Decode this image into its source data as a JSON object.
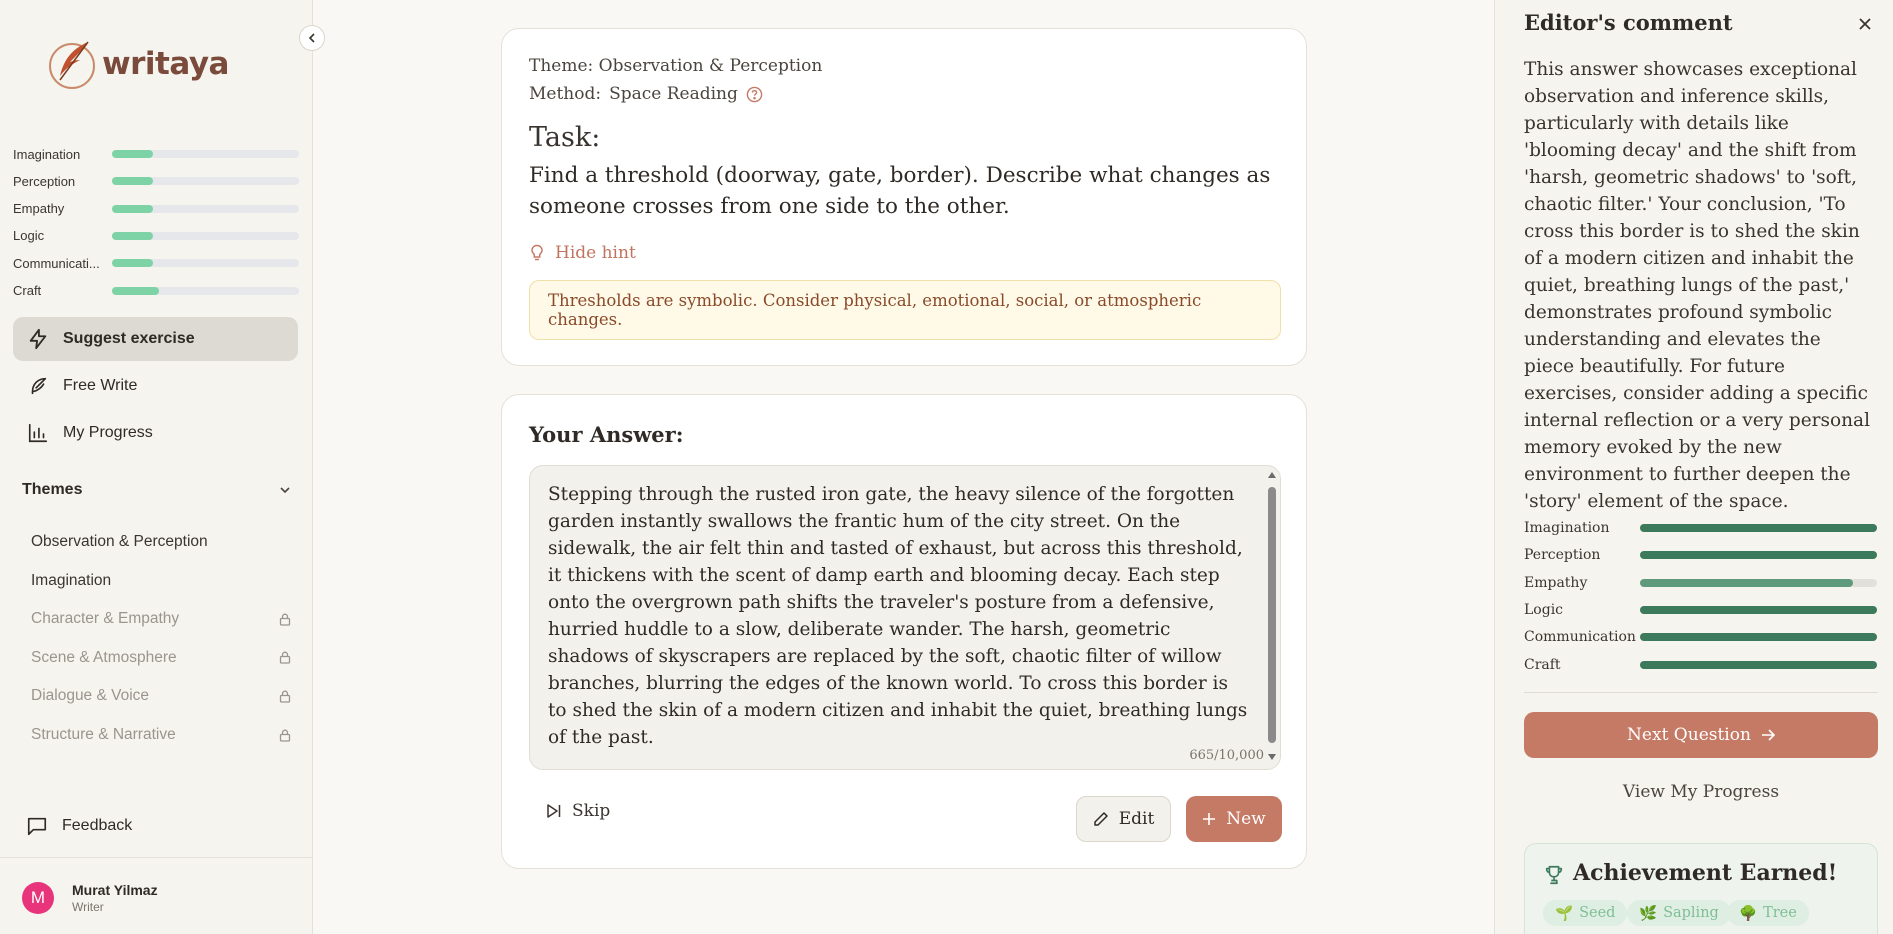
{
  "app": {
    "logo_text": "writaya"
  },
  "sidebar": {
    "skills": [
      {
        "name": "Imagination",
        "level": 0.22
      },
      {
        "name": "Perception",
        "level": 0.22
      },
      {
        "name": "Empathy",
        "level": 0.22
      },
      {
        "name": "Logic",
        "level": 0.22
      },
      {
        "name": "Communicati...",
        "level": 0.22
      },
      {
        "name": "Craft",
        "level": 0.25
      }
    ],
    "nav": [
      {
        "label": "Suggest exercise",
        "icon": "lightning-icon",
        "active": true
      },
      {
        "label": "Free Write",
        "icon": "feather-icon",
        "active": false
      },
      {
        "label": "My Progress",
        "icon": "bar-chart-icon",
        "active": false
      }
    ],
    "themes_label": "Themes",
    "themes": [
      {
        "label": "Observation & Perception",
        "locked": false
      },
      {
        "label": "Imagination",
        "locked": false
      },
      {
        "label": "Character & Empathy",
        "locked": true
      },
      {
        "label": "Scene & Atmosphere",
        "locked": true
      },
      {
        "label": "Dialogue & Voice",
        "locked": true
      },
      {
        "label": "Structure & Narrative",
        "locked": true
      }
    ],
    "feedback_label": "Feedback",
    "user": {
      "initial": "M",
      "name": "Murat Yilmaz",
      "role": "Writer",
      "avatar_color": "#e8347a"
    }
  },
  "task": {
    "theme_line": "Theme: Observation & Perception",
    "method_label": "Method:",
    "method_value": "Space Reading",
    "title": "Task:",
    "text": "Find a threshold (doorway, gate, border). Describe what changes as someone crosses from one side to the other.",
    "hint_toggle": "Hide hint",
    "hint": "Thresholds are symbolic. Consider physical, emotional, social, or atmospheric changes."
  },
  "answer": {
    "title": "Your Answer:",
    "text": "Stepping through the rusted iron gate, the heavy silence of the forgotten garden instantly swallows the frantic hum of the city street. On the sidewalk, the air felt thin and tasted of exhaust, but across this threshold, it thickens with the scent of damp earth and blooming decay. Each step onto the overgrown path shifts the traveler's posture from a defensive, hurried huddle to a slow, deliberate wander. The harsh, geometric shadows of skyscrapers are replaced by the soft, chaotic filter of willow branches, blurring the edges of the known world. To cross this border is to shed the skin of a modern citizen and inhabit the quiet, breathing lungs of the past.",
    "char_count": "665/10,000",
    "skip_label": "Skip",
    "edit_label": "Edit",
    "new_label": "New"
  },
  "editor": {
    "title": "Editor's comment",
    "comment": "This answer showcases exceptional observation and inference skills, particularly with details like 'blooming decay' and the shift from 'harsh, geometric shadows' to 'soft, chaotic filter.' Your conclusion, 'To cross this border is to shed the skin of a modern citizen and inhabit the quiet, breathing lungs of the past,' demonstrates profound symbolic understanding and elevates the piece beautifully. For future exercises, consider adding a specific internal reflection or a very personal memory evoked by the new environment to further deepen the 'story' element of the space.",
    "skills": [
      {
        "name": "Imagination",
        "level": 1.0
      },
      {
        "name": "Perception",
        "level": 1.0
      },
      {
        "name": "Empathy",
        "level": 0.9
      },
      {
        "name": "Logic",
        "level": 1.0
      },
      {
        "name": "Communication",
        "level": 1.0
      },
      {
        "name": "Craft",
        "level": 1.0
      }
    ],
    "next_label": "Next Question",
    "view_progress_label": "View My Progress",
    "achievement_title": "Achievement Earned!",
    "badges": [
      "Seed",
      "Sapling",
      "Tree"
    ]
  },
  "colors": {
    "accent": "#c57a66",
    "skill_low": "#7dd3a5",
    "skill_high": "#3d7a5c",
    "hint_bg": "#fffae8"
  }
}
